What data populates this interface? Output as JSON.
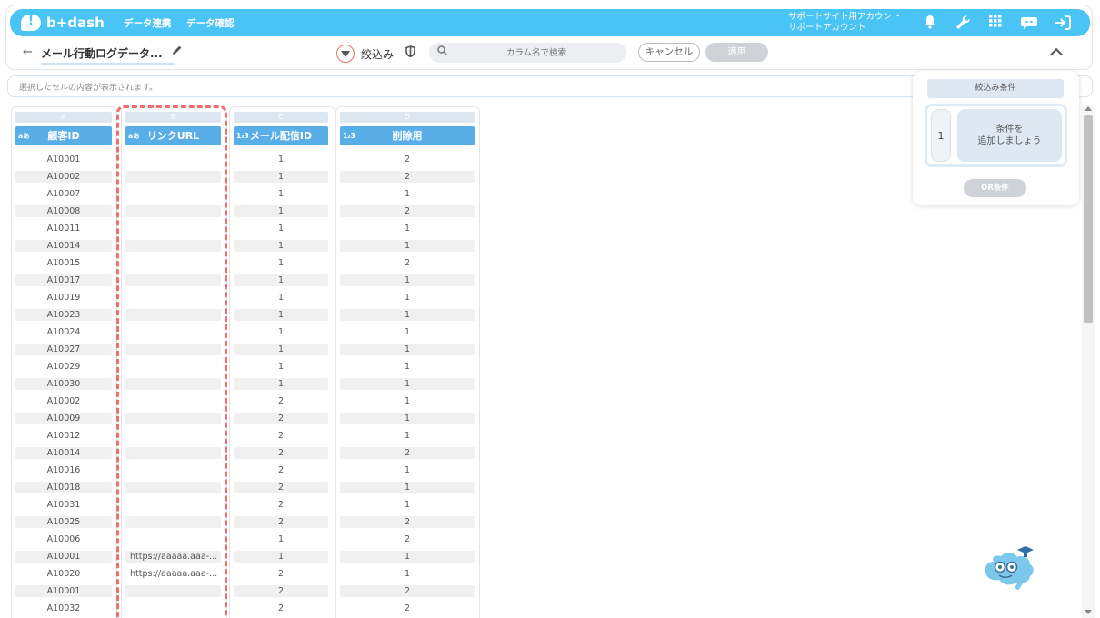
{
  "nav": {
    "logo_text": "b+dash",
    "links": [
      "データ連携",
      "データ確認"
    ],
    "account_line1": "サポートサイト用アカウント",
    "account_line2": "サポートアカウント",
    "icons": [
      "bell-icon",
      "wrench-icon",
      "grid-icon",
      "chat-bot-icon",
      "logout-icon"
    ],
    "accent_color": "#49c4f4"
  },
  "toolbar": {
    "back_arrow": "←",
    "title": "メール行動ログデータ...",
    "filter_label": "絞込み",
    "search_placeholder": "カラム名で検索",
    "cancel_label": "キャンセル",
    "apply_label": "適用"
  },
  "cell_bar": {
    "placeholder": "選択したセルの内容が表示されます。"
  },
  "columns": [
    {
      "letter": "A",
      "type_badge": "aあ",
      "name": "顧客ID",
      "values": [
        "A10001",
        "A10002",
        "A10007",
        "A10008",
        "A10011",
        "A10014",
        "A10015",
        "A10017",
        "A10019",
        "A10023",
        "A10024",
        "A10027",
        "A10029",
        "A10030",
        "A10002",
        "A10009",
        "A10012",
        "A10014",
        "A10016",
        "A10018",
        "A10031",
        "A10025",
        "A10006",
        "A10001",
        "A10020",
        "A10001",
        "A10032"
      ]
    },
    {
      "letter": "B",
      "type_badge": "aあ",
      "name": "リンクURL",
      "values": [
        "",
        "",
        "",
        "",
        "",
        "",
        "",
        "",
        "",
        "",
        "",
        "",
        "",
        "",
        "",
        "",
        "",
        "",
        "",
        "",
        "",
        "",
        "",
        "https://aaaaa.aaa-...",
        "https://aaaaa.aaa-...",
        "",
        ""
      ]
    },
    {
      "letter": "C",
      "type_badge": "1₂3",
      "name": "メール配信ID",
      "values": [
        "1",
        "1",
        "1",
        "1",
        "1",
        "1",
        "1",
        "1",
        "1",
        "1",
        "1",
        "1",
        "1",
        "1",
        "2",
        "2",
        "2",
        "2",
        "2",
        "2",
        "2",
        "2",
        "1",
        "1",
        "2",
        "2",
        "2"
      ]
    },
    {
      "letter": "D",
      "type_badge": "1₂3",
      "name": "削除用",
      "values": [
        "2",
        "2",
        "1",
        "2",
        "1",
        "1",
        "2",
        "1",
        "1",
        "1",
        "1",
        "1",
        "1",
        "1",
        "1",
        "1",
        "1",
        "2",
        "1",
        "1",
        "1",
        "2",
        "2",
        "1",
        "1",
        "2",
        "2"
      ]
    }
  ],
  "filter_panel": {
    "title": "絞込み条件",
    "index": "1",
    "add_line1": "条件を",
    "add_line2": "追加しましょう",
    "or_label": "OR条件"
  }
}
